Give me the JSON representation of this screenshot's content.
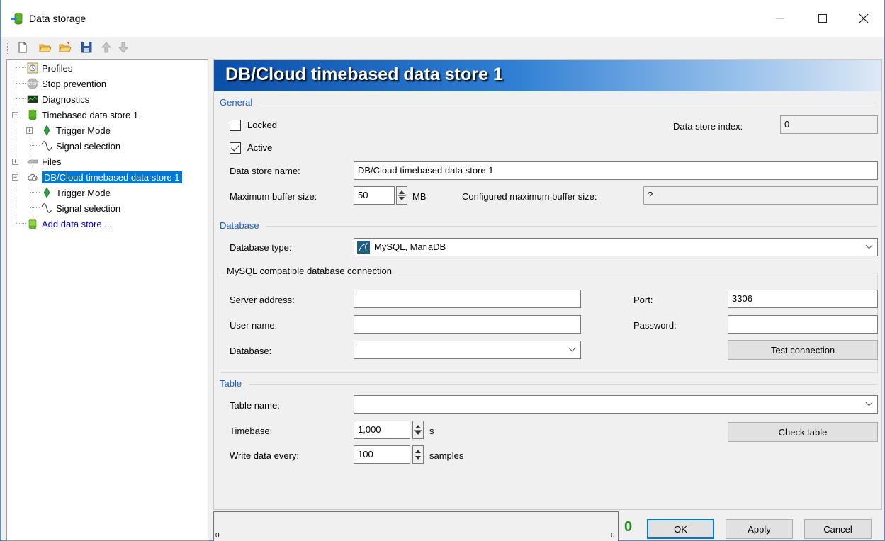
{
  "window": {
    "title": "Data storage"
  },
  "tree": {
    "items": [
      {
        "label": "Profiles"
      },
      {
        "label": "Stop prevention"
      },
      {
        "label": "Diagnostics"
      },
      {
        "label": "Timebased data store 1"
      },
      {
        "label": "Trigger Mode"
      },
      {
        "label": "Signal selection"
      },
      {
        "label": "Files"
      },
      {
        "label": "DB/Cloud timebased data store 1"
      },
      {
        "label": "Trigger Mode"
      },
      {
        "label": "Signal selection"
      },
      {
        "label": "Add data store ..."
      }
    ]
  },
  "banner": {
    "title": "DB/Cloud timebased data store 1"
  },
  "general": {
    "section": "General",
    "locked_label": "Locked",
    "active_label": "Active",
    "index_label": "Data store index:",
    "index_value": "0",
    "name_label": "Data store name:",
    "name_value": "DB/Cloud timebased data store 1",
    "buffer_label": "Maximum buffer size:",
    "buffer_value": "50",
    "buffer_unit": "MB",
    "configured_label": "Configured maximum buffer size:",
    "configured_value": "?"
  },
  "database": {
    "section": "Database",
    "type_label": "Database type:",
    "type_value": "MySQL, MariaDB",
    "group_title": "MySQL compatible database connection",
    "server_label": "Server address:",
    "server_value": "",
    "port_label": "Port:",
    "port_value": "3306",
    "user_label": "User name:",
    "user_value": "",
    "password_label": "Password:",
    "password_value": "",
    "db_label": "Database:",
    "db_value": "",
    "test_button": "Test connection"
  },
  "table": {
    "section": "Table",
    "name_label": "Table name:",
    "name_value": "",
    "timebase_label": "Timebase:",
    "timebase_value": "1,000",
    "timebase_unit": "s",
    "write_label": "Write data every:",
    "write_value": "100",
    "write_unit": "samples",
    "check_button": "Check table"
  },
  "status": {
    "left_min": "0",
    "left_max": "0",
    "counter": "0"
  },
  "footer": {
    "ok": "OK",
    "apply": "Apply",
    "cancel": "Cancel"
  },
  "colors": {
    "accent": "#0078d7",
    "section": "#1a5dcc",
    "counter": "#1e8c1e"
  }
}
